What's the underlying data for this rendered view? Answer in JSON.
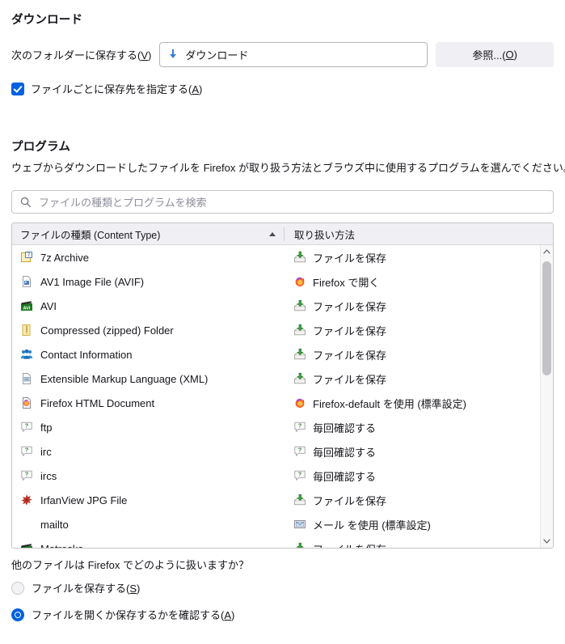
{
  "downloads": {
    "section_title": "ダウンロード",
    "folder_label": "次のフォルダーに保存する(V)",
    "folder_label_main": "次のフォルダーに保存する(",
    "folder_label_key": "V",
    "folder_label_end": ")",
    "folder_value": "ダウンロード",
    "folder_icon": "download-arrow-icon",
    "browse_main": "参照...(",
    "browse_key": "O",
    "browse_end": ")",
    "browse_label": "参照...(O)",
    "checkbox_checked": true,
    "checkbox_main": "ファイルごとに保存先を指定する(",
    "checkbox_key": "A",
    "checkbox_end": ")",
    "checkbox_label": "ファイルごとに保存先を指定する(A)"
  },
  "programs": {
    "section_title": "プログラム",
    "description": "ウェブからダウンロードしたファイルを Firefox が取り扱う方法とブラウズ中に使用するプログラムを選んでください。",
    "search_placeholder": "ファイルの種類とプログラムを検索",
    "search_value": "",
    "search_icon": "search-icon",
    "columns": {
      "type": "ファイルの種類 (Content Type)",
      "action": "取り扱い方法",
      "sort_column": "type",
      "sort_direction": "ascending"
    },
    "rows": [
      {
        "type": "7z Archive",
        "type_icon": "archive-7z-icon",
        "action": "ファイルを保存",
        "action_icon": "save-file-icon"
      },
      {
        "type": "AV1 Image File (AVIF)",
        "type_icon": "image-file-icon",
        "action": "Firefox で開く",
        "action_icon": "firefox-icon"
      },
      {
        "type": "AVI",
        "type_icon": "avi-video-icon",
        "action": "ファイルを保存",
        "action_icon": "save-file-icon"
      },
      {
        "type": "Compressed (zipped) Folder",
        "type_icon": "zip-folder-icon",
        "action": "ファイルを保存",
        "action_icon": "save-file-icon"
      },
      {
        "type": "Contact Information",
        "type_icon": "contacts-icon",
        "action": "ファイルを保存",
        "action_icon": "save-file-icon"
      },
      {
        "type": "Extensible Markup Language (XML)",
        "type_icon": "xml-file-icon",
        "action": "ファイルを保存",
        "action_icon": "save-file-icon"
      },
      {
        "type": "Firefox HTML Document",
        "type_icon": "firefox-doc-icon",
        "action": "Firefox-default を使用 (標準設定)",
        "action_icon": "firefox-icon"
      },
      {
        "type": "ftp",
        "type_icon": "unknown-type-icon",
        "action": "毎回確認する",
        "action_icon": "unknown-type-icon"
      },
      {
        "type": "irc",
        "type_icon": "unknown-type-icon",
        "action": "毎回確認する",
        "action_icon": "unknown-type-icon"
      },
      {
        "type": "ircs",
        "type_icon": "unknown-type-icon",
        "action": "毎回確認する",
        "action_icon": "unknown-type-icon"
      },
      {
        "type": "IrfanView JPG File",
        "type_icon": "irfanview-icon",
        "action": "ファイルを保存",
        "action_icon": "save-file-icon"
      },
      {
        "type": "mailto",
        "type_icon": "none",
        "action": "メール を使用 (標準設定)",
        "action_icon": "mail-app-icon"
      },
      {
        "type": "Matroska",
        "type_icon": "avi-video-icon",
        "action": "ファイルを保存",
        "action_icon": "save-file-icon"
      }
    ],
    "scrollbar": {
      "up_arrow": "▲",
      "down_arrow": "▼"
    }
  },
  "other_files": {
    "question": "他のファイルは Firefox でどのように扱いますか？",
    "options": [
      {
        "main": "ファイルを保存する(",
        "key": "S",
        "end": ")",
        "label": "ファイルを保存する(S)",
        "selected": false
      },
      {
        "main": "ファイルを開くか保存するかを確認する(",
        "key": "A",
        "end": ")",
        "label": "ファイルを開くか保存するかを確認する(A)",
        "selected": true
      }
    ]
  },
  "colors": {
    "accent": "#0060df",
    "text": "#15141a",
    "placeholder": "#8f8f9d",
    "header_bg": "#f0f0f4",
    "border": "#c5c4c8",
    "save_icon_green": "#3c9c3c",
    "firefox_orange": "#ff9500"
  }
}
